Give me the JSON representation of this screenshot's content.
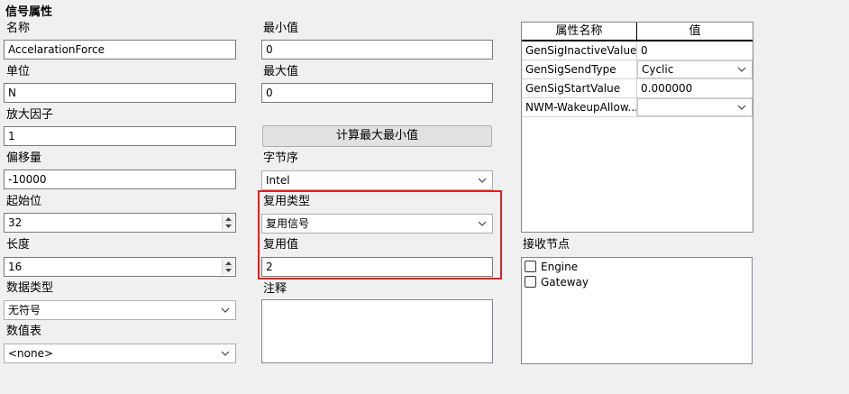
{
  "group_title": "信号属性",
  "left": {
    "name": {
      "label": "名称",
      "value": "AccelarationForce"
    },
    "unit": {
      "label": "单位",
      "value": "N"
    },
    "factor": {
      "label": "放大因子",
      "value": "1"
    },
    "offset": {
      "label": "偏移量",
      "value": "-10000"
    },
    "start_bit": {
      "label": "起始位",
      "value": "32"
    },
    "length": {
      "label": "长度",
      "value": "16"
    },
    "data_type": {
      "label": "数据类型",
      "value": "无符号"
    },
    "value_table": {
      "label": "数值表",
      "value": "<none>"
    }
  },
  "middle": {
    "min": {
      "label": "最小值",
      "value": "0"
    },
    "max": {
      "label": "最大值",
      "value": "0"
    },
    "calc_button": "计算最大最小值",
    "byte_order": {
      "label": "字节序",
      "value": "Intel"
    },
    "mux_type": {
      "label": "复用类型",
      "value": "复用信号"
    },
    "mux_value": {
      "label": "复用值",
      "value": "2"
    },
    "comment": {
      "label": "注释",
      "value": ""
    }
  },
  "props": {
    "headers": [
      "属性名称",
      "值"
    ],
    "rows": [
      {
        "name": "GenSigInactiveValue",
        "value": "0",
        "type": "text"
      },
      {
        "name": "GenSigSendType",
        "value": "Cyclic",
        "type": "combo"
      },
      {
        "name": "GenSigStartValue",
        "value": "0.000000",
        "type": "text"
      },
      {
        "name": "NWM-WakeupAllow...",
        "value": "",
        "type": "combo"
      }
    ]
  },
  "receivers": {
    "label": "接收节点",
    "items": [
      {
        "name": "Engine",
        "checked": false
      },
      {
        "name": "Gateway",
        "checked": false
      }
    ]
  },
  "colors": {
    "highlight": "#e02020"
  }
}
